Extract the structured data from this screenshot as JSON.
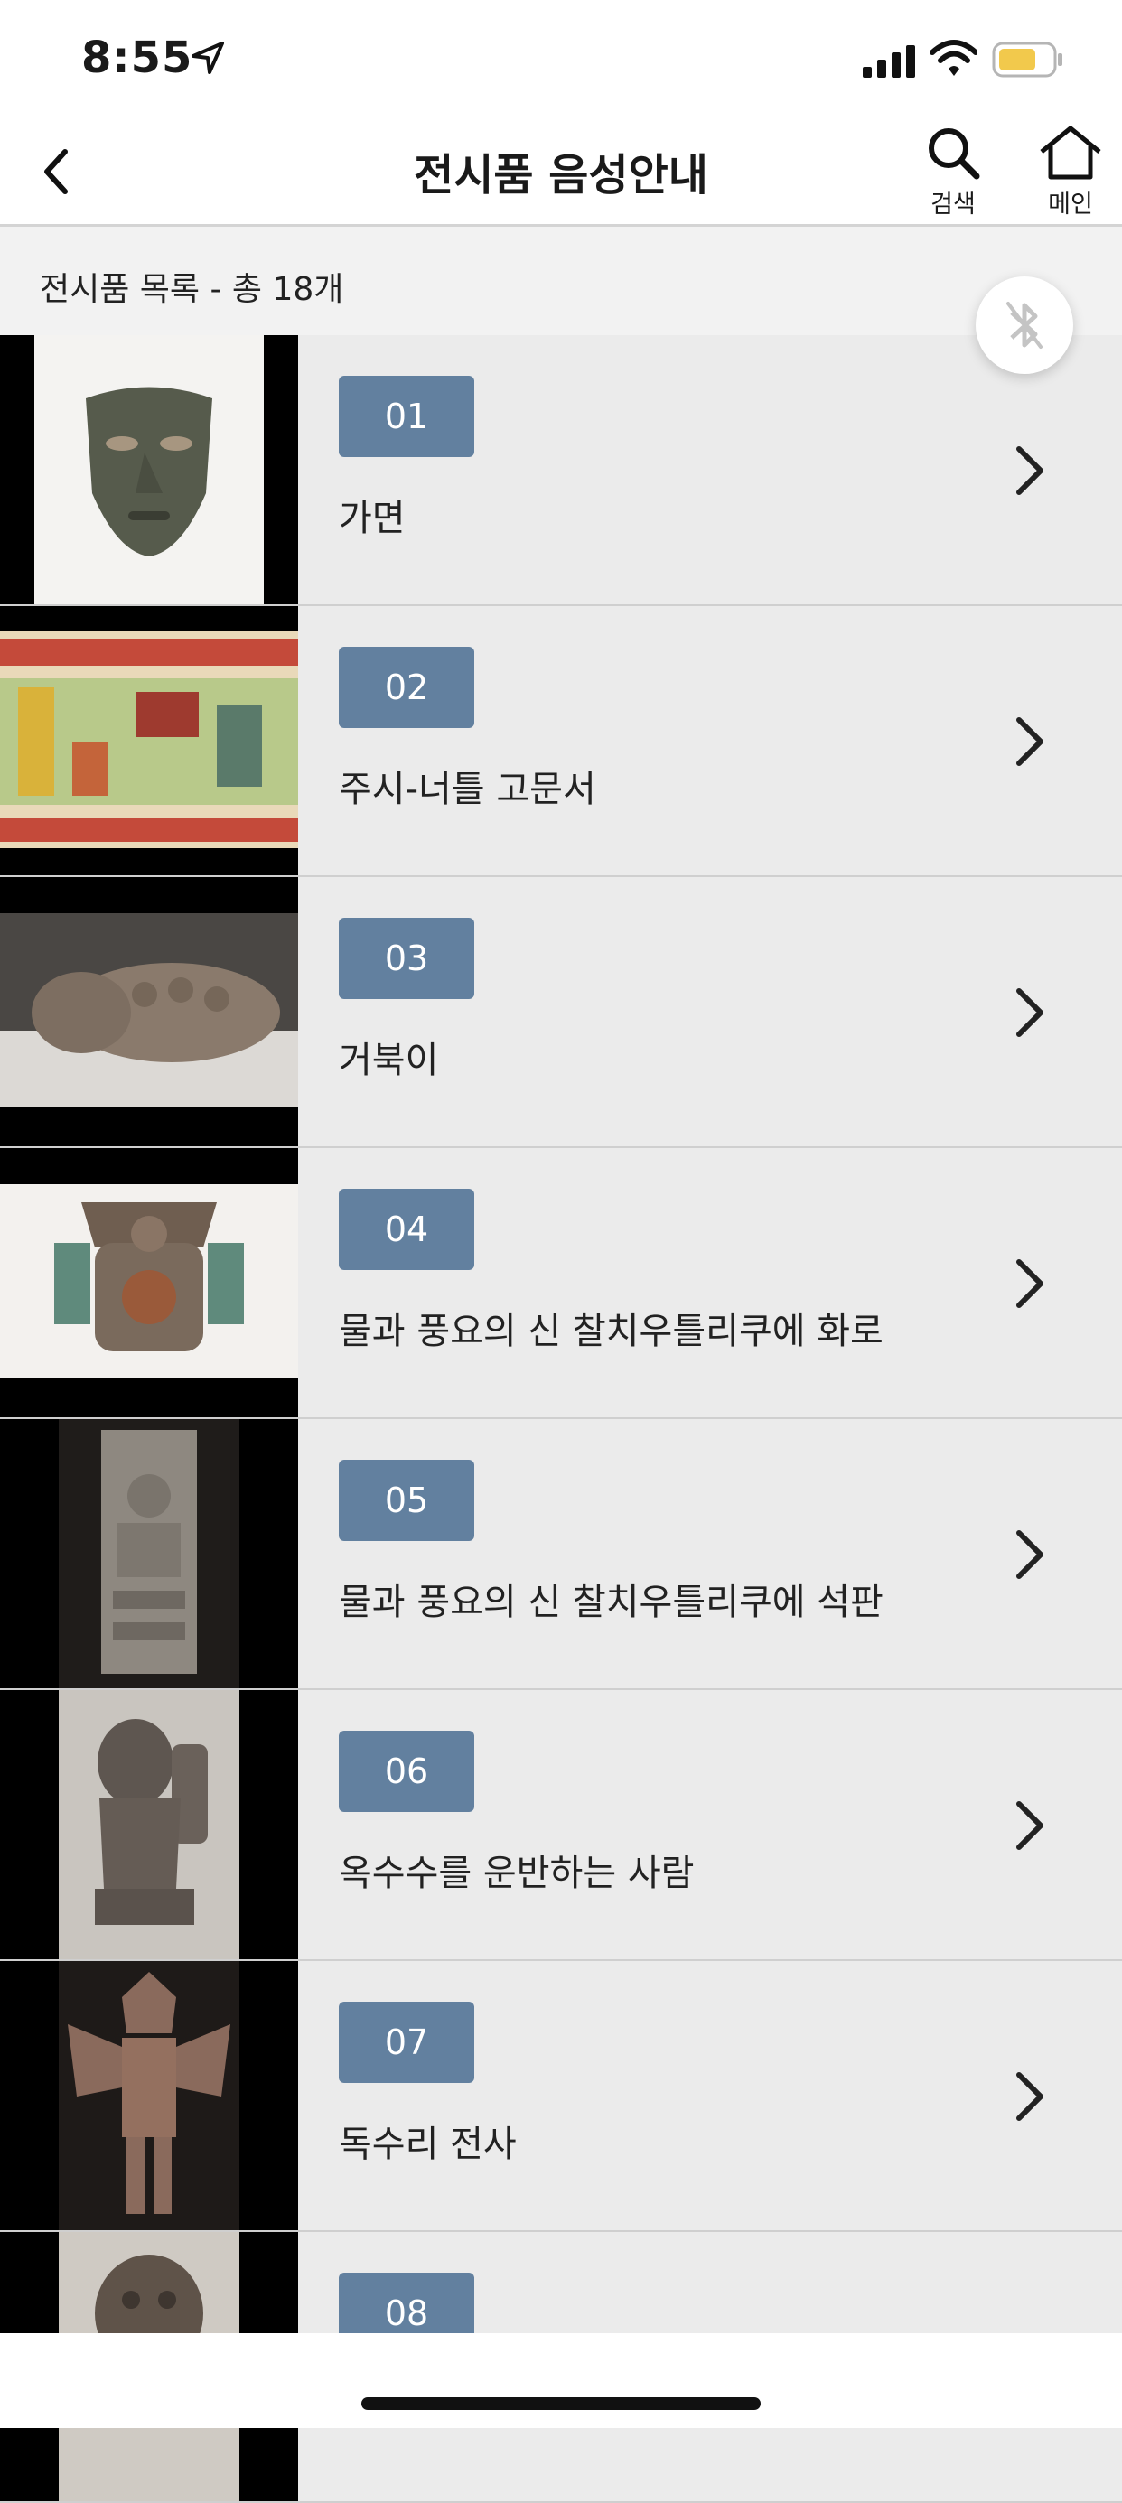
{
  "status_bar": {
    "time": "8:55",
    "icons": [
      "location-arrow-icon",
      "signal-icon",
      "wifi-icon",
      "battery-icon"
    ],
    "battery_color": "#f2c94c"
  },
  "header": {
    "title": "전시품 음성안내",
    "search_label": "검색",
    "home_label": "메인"
  },
  "summary": {
    "text": "전시품 목록 - 총 18개"
  },
  "colors": {
    "badge": "#62809f",
    "row_bg": "#ebebeb",
    "summary_bg": "#f2f2f2"
  },
  "items": [
    {
      "number": "01",
      "title": "가면"
    },
    {
      "number": "02",
      "title": "주시-너틀 고문서"
    },
    {
      "number": "03",
      "title": "거북이"
    },
    {
      "number": "04",
      "title": "물과 풍요의 신 찰치우틀리쿠에 화로"
    },
    {
      "number": "05",
      "title": "물과 풍요의 신 찰치우틀리쿠에 석판"
    },
    {
      "number": "06",
      "title": "옥수수를 운반하는 사람"
    },
    {
      "number": "07",
      "title": "독수리 전사"
    },
    {
      "number": "08",
      "title": ""
    }
  ]
}
